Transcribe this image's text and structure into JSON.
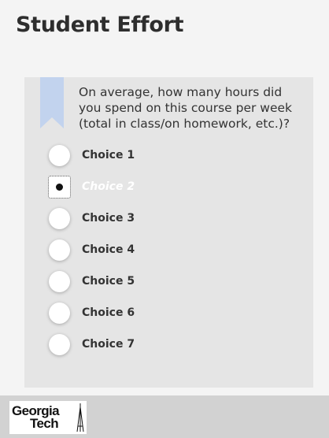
{
  "page": {
    "title": "Student Effort"
  },
  "question": {
    "text": "On average, how many hours did you spend on this course per week (total in class/on homework, etc.)?",
    "selected_index": 1,
    "choices": [
      {
        "label": "Choice 1"
      },
      {
        "label": "Choice 2"
      },
      {
        "label": "Choice 3"
      },
      {
        "label": "Choice 4"
      },
      {
        "label": "Choice 5"
      },
      {
        "label": "Choice 6"
      },
      {
        "label": "Choice 7"
      }
    ]
  },
  "footer": {
    "logo_line1": "Georgia",
    "logo_line2": "Tech"
  },
  "colors": {
    "background": "#f4f4f4",
    "card": "#e5e5e5",
    "bookmark": "#c2d3ee",
    "footer": "#d2d2d2"
  }
}
